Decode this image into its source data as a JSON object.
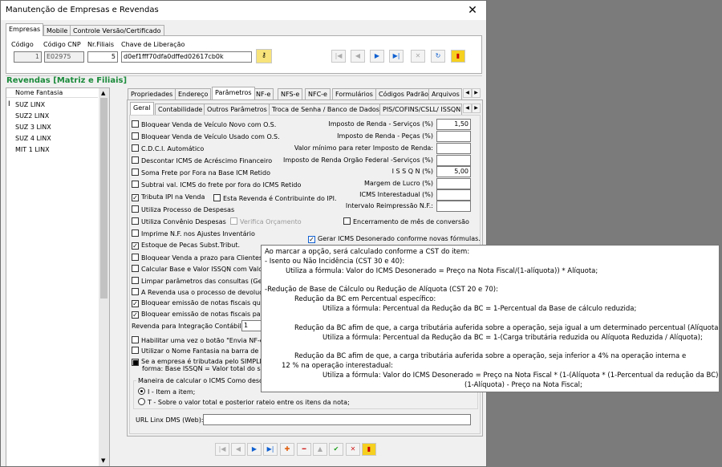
{
  "window": {
    "title": "Manutenção de Empresas e Revendas",
    "close": "✕"
  },
  "top_tabs": [
    "Empresas",
    "Mobile",
    "Controle Versão/Certificado"
  ],
  "header_fields": {
    "codigo_label": "Código",
    "codigo_value": "1",
    "codigo_cnp_label": "Código CNP",
    "codigo_cnp_value": "E02975",
    "nr_filiais_label": "Nr.Filiais",
    "nr_filiais_value": "5",
    "chave_label": "Chave de Liberação",
    "chave_value": "d0ef1fff70dfa0dffed02617cb0k"
  },
  "top_nav": [
    "|◀",
    "◀",
    "▶",
    "▶|",
    "✕",
    "↻",
    "▮"
  ],
  "section_title": "Revendas [Matriz e Filiais]",
  "store_list": {
    "header": "Nome Fantasia",
    "items": [
      "SUZ LINX",
      "SUZ2 LINX",
      "SUZ 3 LINX",
      "SUZ 4 LINX",
      "MIT 1 LINX"
    ]
  },
  "tabs_row1": [
    "Propriedades",
    "Endereço",
    "Parâmetros",
    "NF-e",
    "NFS-e",
    "NFC-e",
    "Formulários",
    "Códigos Padrão",
    "Arquivos"
  ],
  "tabs_row2": [
    "Geral",
    "Contabilidade",
    "Outros Parâmetros",
    "Troca de Senha / Banco de Dados",
    "PIS/COFINS/CSLL/ ISSQN"
  ],
  "left_checks": [
    {
      "label": "Bloquear Venda de Veículo Novo com O.S.",
      "checked": false
    },
    {
      "label": "Bloquear Venda de Veículo Usado com O.S.",
      "checked": false
    },
    {
      "label": "C.D.C.I. Automático",
      "checked": false
    },
    {
      "label": "Descontar ICMS de Acréscimo Financeiro",
      "checked": false
    },
    {
      "label": "Soma Frete por Fora na Base ICM Retido",
      "checked": false
    },
    {
      "label": "Subtrai  val. ICMS do frete por fora do ICMS Retido",
      "checked": false
    },
    {
      "label": "Tributa IPI na Venda",
      "checked": true
    },
    {
      "label": "Utiliza Processo de Despesas",
      "checked": false
    },
    {
      "label": "Utiliza Convênio Despesas",
      "checked": false
    },
    {
      "label": "Imprime N.F. nos Ajustes Inventário",
      "checked": false
    },
    {
      "label": "Estoque de Pecas Subst.Tribut.",
      "checked": true
    },
    {
      "label": "Bloquear Venda a prazo para Clientes se",
      "checked": false
    },
    {
      "label": "Calcular Base e Valor ISSQN com Valor B",
      "checked": false
    },
    {
      "label": "Limpar parâmetros das consultas  (Gere",
      "checked": false
    },
    {
      "label": "A Revenda usa o processo de devolução",
      "checked": false
    },
    {
      "label": "Bloquear emissão de notas fiscais  quan",
      "checked": true
    },
    {
      "label": "Bloquear emissão de notas fiscais para o",
      "checked": true
    }
  ],
  "contribuinte_ipi": {
    "label": "Esta Revenda é Contribuinte do IPI.",
    "checked": false
  },
  "verifica_orcamento": {
    "label": "Verifica Orçamento",
    "checked": false
  },
  "encerramento": {
    "label": "Encerramento de mês de conversão",
    "checked": false
  },
  "gerar_icms": {
    "label": "Gerar ICMS Desonerado conforme novas fórmulas.",
    "checked": true
  },
  "right_fields": [
    {
      "label": "Imposto de Renda  - Serviços (%)",
      "value": "1,50"
    },
    {
      "label": "Imposto de Renda - Peças (%)",
      "value": ""
    },
    {
      "label": "Valor mínimo para reter Imposto de Renda:",
      "value": ""
    },
    {
      "label": "Imposto de Renda Orgão Federal -Serviços (%)",
      "value": ""
    },
    {
      "label": "I S S Q N  (%)",
      "value": "5,00"
    },
    {
      "label": "Margem de Lucro (%)",
      "value": ""
    },
    {
      "label": "ICMS Interestadual (%)",
      "value": ""
    },
    {
      "label": "Intervalo Reimpressão N.F.:",
      "value": ""
    }
  ],
  "integracao": {
    "label": "Revenda para Integração Contábil",
    "value": "1"
  },
  "lower_checks": [
    {
      "label": "Habilitar uma vez o botão \"Envia NF-e pa",
      "checked": false
    },
    {
      "label": "Utilizar o Nome Fantasia na barra de roc",
      "checked": false
    }
  ],
  "simples": {
    "line1": "Se a empresa é tributada pelo SIMPLES",
    "line2": "forma: Base ISSQN =  Valor total do ser",
    "checked": true
  },
  "calc_icms": {
    "title": "Maneira de calcular o ICMS Como descont",
    "options": [
      "I - Item a item;",
      "T - Sobre o valor total e posterior rateio entre os itens da nota;"
    ],
    "selected": 0
  },
  "url_linx": {
    "label": "URL Linx DMS (Web):",
    "value": ""
  },
  "bottom_nav": [
    "|◀",
    "◀",
    "▶",
    "▶|",
    "✚",
    "━",
    "▲",
    "✔",
    "✕",
    "▮"
  ],
  "tooltip": {
    "l1": "Ao marcar a opção, será calculado conforme a CST do item:",
    "l2": "- Isento ou Não Incidência (CST 30 e 40):",
    "l3": "Utiliza a fórmula: Valor do ICMS Desonerado = Preço na Nota Fiscal/(1-alíquota)) * Alíquota;",
    "l4": "-Redução de Base de Cálculo ou Redução de Alíquota (CST 20 e 70):",
    "l5": "Redução da BC em Percentual específico:",
    "l6": "Utiliza a fórmula: Percentual da Redução da BC = 1-Percentual da Base de cálculo reduzida;",
    "l7": "Redução da BC afim de que, a carga tributária auferida sobre a operação, seja igual a um determinado percentual (Alíquota):",
    "l8": "Utiliza a fórmula: Percentual da Redução da BC = 1-(Carga tributária reduzida ou Alíquota Reduzida / Alíquota);",
    "l9": "Redução da BC afim de que, a carga tributária auferida sobre a operação, seja inferior a 4% na operação interna e",
    "l10": "12 % na operação interestadual:",
    "l11": "Utiliza a fórmula: Valor do ICMS Desonerado = Preço na Nota Fiscal * (1-(Alíquota * (1-Percentual da redução da BC))) /",
    "l12": "(1-Alíquota) - Preço na Nota Fiscal;"
  }
}
